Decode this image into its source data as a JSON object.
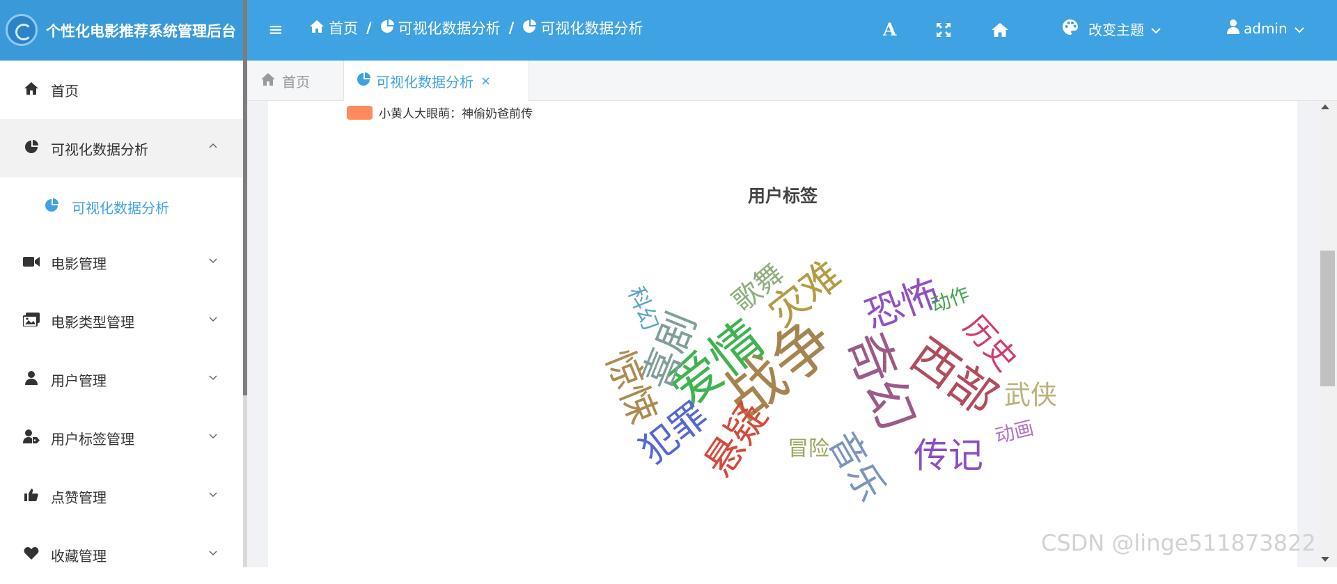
{
  "header": {
    "app_title": "个性化电影推荐系统管理后台",
    "breadcrumbs": [
      "首页",
      "可视化数据分析",
      "可视化数据分析"
    ],
    "theme_label": "改变主题",
    "user_label": "admin",
    "font_icon_glyph": "A",
    "background_color": "#3fa2e2"
  },
  "sidebar": {
    "items": [
      {
        "label": "首页",
        "icon": "home-icon"
      },
      {
        "label": "可视化数据分析",
        "icon": "chart-pie-icon",
        "expanded": true
      },
      {
        "label": "可视化数据分析",
        "icon": "chart-pie-icon",
        "submenu": true,
        "active": true
      },
      {
        "label": "电影管理",
        "icon": "video-camera-icon"
      },
      {
        "label": "电影类型管理",
        "icon": "images-icon"
      },
      {
        "label": "用户管理",
        "icon": "user-icon"
      },
      {
        "label": "用户标签管理",
        "icon": "user-tag-icon"
      },
      {
        "label": "点赞管理",
        "icon": "thumbs-up-icon"
      },
      {
        "label": "收藏管理",
        "icon": "heart-icon"
      }
    ]
  },
  "tabs": [
    {
      "label": "首页",
      "active": false
    },
    {
      "label": "可视化数据分析",
      "active": true,
      "close": "×"
    }
  ],
  "legend": {
    "label": "小黄人大眼萌：神偷奶爸前传",
    "color": "#ff8a5c"
  },
  "chart_data": {
    "type": "wordcloud",
    "title": "用户标签",
    "words": [
      {
        "text": "战争",
        "color": "#a6844f"
      },
      {
        "text": "爱情",
        "color": "#3fb34f"
      },
      {
        "text": "奇幻",
        "color": "#9c5a87"
      },
      {
        "text": "西部",
        "color": "#b14c5c"
      },
      {
        "text": "灾难",
        "color": "#b39b44"
      },
      {
        "text": "喜剧",
        "color": "#7f9e9a"
      },
      {
        "text": "惊悚",
        "color": "#ad8a4f"
      },
      {
        "text": "恐怖",
        "color": "#9050c2"
      },
      {
        "text": "悬疑",
        "color": "#d6493a"
      },
      {
        "text": "犯罪",
        "color": "#5566d6"
      },
      {
        "text": "音乐",
        "color": "#7a95b8"
      },
      {
        "text": "传记",
        "color": "#8a4fc4"
      },
      {
        "text": "历史",
        "color": "#d23b6e"
      },
      {
        "text": "歌舞",
        "color": "#8fae7d"
      },
      {
        "text": "武侠",
        "color": "#bcb17a"
      },
      {
        "text": "科幻",
        "color": "#5aa6c4"
      },
      {
        "text": "动作",
        "color": "#3fa74a"
      },
      {
        "text": "动画",
        "color": "#b272c4"
      },
      {
        "text": "冒险",
        "color": "#9aa65c"
      }
    ]
  },
  "watermark": "CSDN @linge511873822"
}
